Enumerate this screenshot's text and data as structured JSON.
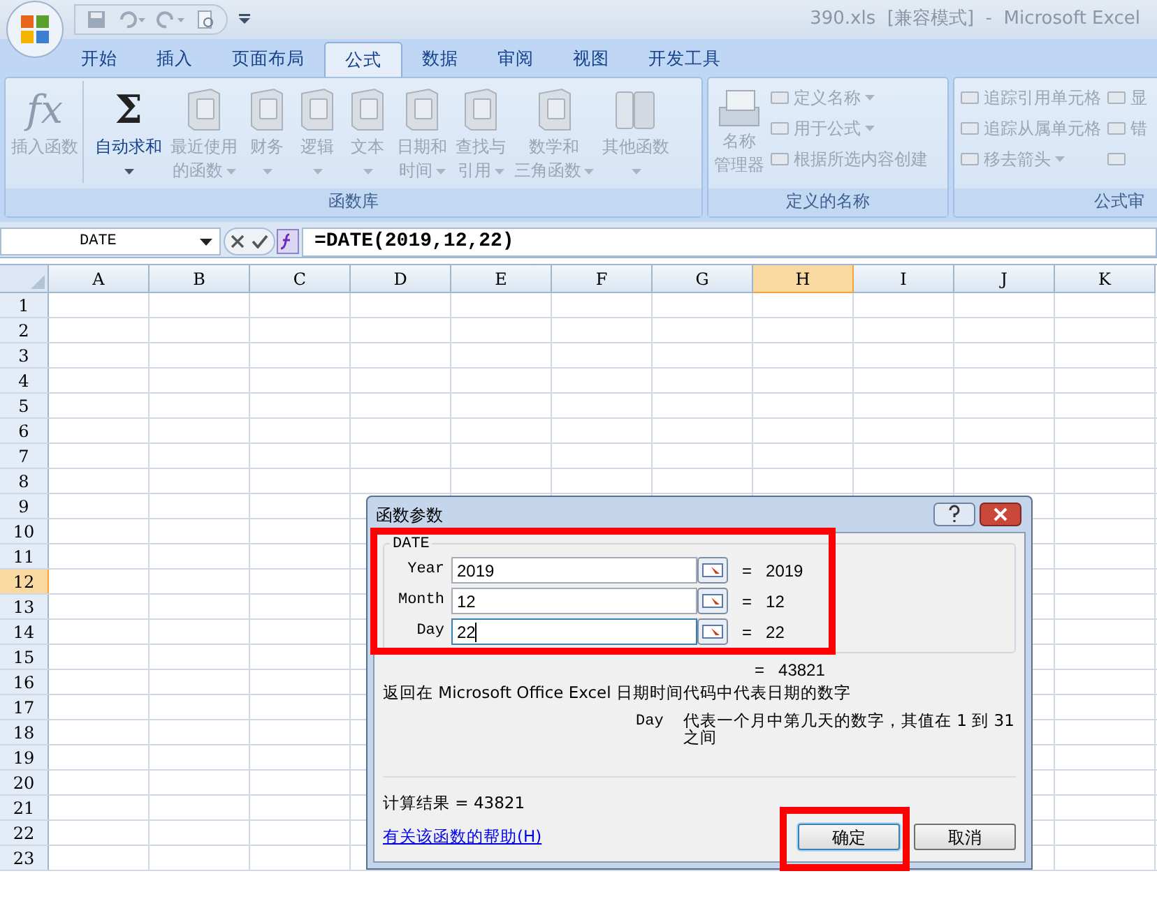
{
  "window": {
    "title": "390.xls  [兼容模式]  -  Microsoft Excel"
  },
  "tabs": [
    {
      "label": "开始",
      "selected": false
    },
    {
      "label": "插入",
      "selected": false
    },
    {
      "label": "页面布局",
      "selected": false
    },
    {
      "label": "公式",
      "selected": true
    },
    {
      "label": "数据",
      "selected": false
    },
    {
      "label": "审阅",
      "selected": false
    },
    {
      "label": "视图",
      "selected": false
    },
    {
      "label": "开发工具",
      "selected": false
    }
  ],
  "ribbon": {
    "function_library": {
      "label": "函数库",
      "buttons": [
        {
          "kind": "glyph",
          "glyph": "fx",
          "lines": [
            "插入函数"
          ],
          "dropdown": false,
          "disabled": true
        },
        {
          "kind": "glyph",
          "glyph": "Σ",
          "lines": [
            "自动求和"
          ],
          "dropdown": true,
          "disabled": false
        },
        {
          "kind": "book",
          "lines": [
            "最近使用",
            "的函数"
          ],
          "dropdown": true,
          "disabled": true
        },
        {
          "kind": "book",
          "lines": [
            "财务"
          ],
          "dropdown": true,
          "disabled": true
        },
        {
          "kind": "book",
          "lines": [
            "逻辑"
          ],
          "dropdown": true,
          "disabled": true
        },
        {
          "kind": "book",
          "lines": [
            "文本"
          ],
          "dropdown": true,
          "disabled": true
        },
        {
          "kind": "book",
          "lines": [
            "日期和",
            "时间"
          ],
          "dropdown": true,
          "disabled": true
        },
        {
          "kind": "book",
          "lines": [
            "查找与",
            "引用"
          ],
          "dropdown": true,
          "disabled": true
        },
        {
          "kind": "book",
          "lines": [
            "数学和",
            "三角函数"
          ],
          "dropdown": true,
          "disabled": true
        },
        {
          "kind": "books",
          "lines": [
            "其他函数"
          ],
          "dropdown": true,
          "disabled": true
        }
      ]
    },
    "defined_names": {
      "label": "定义的名称",
      "manager": {
        "lines": [
          "名称",
          "管理器"
        ],
        "disabled": true
      },
      "items": [
        {
          "label": "定义名称",
          "dropdown": true,
          "disabled": true
        },
        {
          "label": "用于公式",
          "dropdown": true,
          "disabled": true
        },
        {
          "label": "根据所选内容创建",
          "dropdown": false,
          "disabled": true
        }
      ]
    },
    "formula_auditing": {
      "label": "公式审",
      "items": [
        {
          "label": "追踪引用单元格",
          "dropdown": false,
          "disabled": true
        },
        {
          "label": "追踪从属单元格",
          "dropdown": false,
          "disabled": true
        },
        {
          "label": "移去箭头",
          "dropdown": true,
          "disabled": true
        }
      ],
      "side_items": [
        {
          "label": "显"
        },
        {
          "label": "错"
        }
      ]
    }
  },
  "name_box": {
    "value": "DATE"
  },
  "formula_bar": {
    "value": "=DATE(2019,12,22)"
  },
  "sheet": {
    "columns": [
      {
        "label": "A",
        "selected": false
      },
      {
        "label": "B",
        "selected": false
      },
      {
        "label": "C",
        "selected": false
      },
      {
        "label": "D",
        "selected": false
      },
      {
        "label": "E",
        "selected": false
      },
      {
        "label": "F",
        "selected": false
      },
      {
        "label": "G",
        "selected": false
      },
      {
        "label": "H",
        "selected": true
      },
      {
        "label": "I",
        "selected": false
      },
      {
        "label": "J",
        "selected": false
      },
      {
        "label": "K",
        "selected": false
      }
    ],
    "rows": [
      {
        "label": "1",
        "selected": false
      },
      {
        "label": "2",
        "selected": false
      },
      {
        "label": "3",
        "selected": false
      },
      {
        "label": "4",
        "selected": false
      },
      {
        "label": "5",
        "selected": false
      },
      {
        "label": "6",
        "selected": false
      },
      {
        "label": "7",
        "selected": false
      },
      {
        "label": "8",
        "selected": false
      },
      {
        "label": "9",
        "selected": false
      },
      {
        "label": "10",
        "selected": false
      },
      {
        "label": "11",
        "selected": false
      },
      {
        "label": "12",
        "selected": true
      },
      {
        "label": "13",
        "selected": false
      },
      {
        "label": "14",
        "selected": false
      },
      {
        "label": "15",
        "selected": false
      },
      {
        "label": "16",
        "selected": false
      },
      {
        "label": "17",
        "selected": false
      },
      {
        "label": "18",
        "selected": false
      },
      {
        "label": "19",
        "selected": false
      },
      {
        "label": "20",
        "selected": false
      },
      {
        "label": "21",
        "selected": false
      },
      {
        "label": "22",
        "selected": false
      },
      {
        "label": "23",
        "selected": false
      }
    ]
  },
  "dialog": {
    "title": "函数参数",
    "function_name": "DATE",
    "arguments": [
      {
        "label": "Year",
        "value": "2019",
        "result": "2019",
        "focused": false
      },
      {
        "label": "Month",
        "value": "12",
        "result": "12",
        "focused": false
      },
      {
        "label": "Day",
        "value": "22",
        "result": "22",
        "focused": true
      }
    ],
    "equals": "=",
    "total": "43821",
    "description": "返回在 Microsoft Office Excel 日期时间代码中代表日期的数字",
    "argument_name": "Day",
    "argument_help": "代表一个月中第几天的数字，其值在 1 到 31 之间",
    "result_label": "计算结果 =",
    "result_value": "43821",
    "help_link": "有关该函数的帮助(H)",
    "buttons": [
      {
        "label": "确定",
        "default": true
      },
      {
        "label": "取消",
        "default": false
      }
    ]
  }
}
